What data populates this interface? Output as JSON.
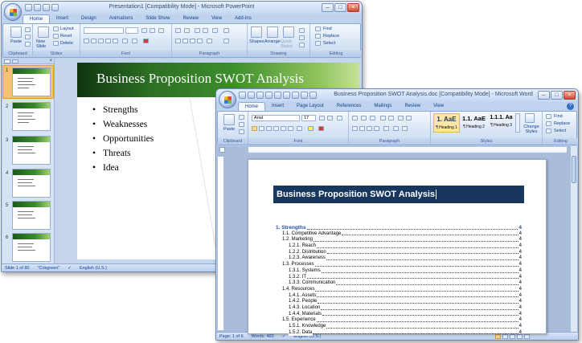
{
  "powerpoint": {
    "title": "Presentation1 [Compatibility Mode] - Microsoft PowerPoint",
    "tabs": [
      "Home",
      "Insert",
      "Design",
      "Animations",
      "Slide Show",
      "Review",
      "View",
      "Add-Ins"
    ],
    "groups": {
      "clipboard": "Clipboard",
      "slides": "Slides",
      "font": "Font",
      "paragraph": "Paragraph",
      "drawing": "Drawing",
      "editing": "Editing"
    },
    "buttons": {
      "paste": "Paste",
      "new_slide": "New Slide",
      "layout": "Layout",
      "reset": "Reset",
      "delete": "Delete",
      "shapes": "Shapes",
      "arrange": "Arrange",
      "quick_styles": "Quick Styles",
      "find": "Find",
      "replace": "Replace",
      "select": "Select"
    },
    "thumbnails": [
      "1",
      "2",
      "3",
      "4",
      "5",
      "6"
    ],
    "slide": {
      "title": "Business Proposition SWOT Analysis",
      "bullets": [
        "Strengths",
        "Weaknesses",
        "Opportunities",
        "Threats",
        "Idea"
      ]
    },
    "status": {
      "slide": "Slide 1 of 80",
      "theme": "\"Crisgreen\"",
      "language": "English (U.S.)"
    }
  },
  "word": {
    "title": "Business Proposition SWOT Analysis.doc [Compatibility Mode] - Microsoft Word",
    "tabs": [
      "Home",
      "Insert",
      "Page Layout",
      "References",
      "Mailings",
      "Review",
      "View"
    ],
    "groups": {
      "clipboard": "Clipboard",
      "font": "Font",
      "paragraph": "Paragraph",
      "styles": "Styles",
      "editing": "Editing"
    },
    "font_name": "Arial",
    "font_size": "17",
    "buttons": {
      "paste": "Paste",
      "change_styles": "Change Styles",
      "find": "Find",
      "replace": "Replace",
      "select": "Select"
    },
    "styles": [
      {
        "preview": "1. AaE",
        "name": "¶ Heading 1"
      },
      {
        "preview": "1.1. AaE",
        "name": "¶ Heading 2"
      },
      {
        "preview": "1.1.1. Aa",
        "name": "¶ Heading 3"
      }
    ],
    "document": {
      "title": "Business Proposition SWOT Analysis",
      "toc": [
        {
          "text": "1. Strengths",
          "page": "4",
          "level": 1
        },
        {
          "text": "1.1. Competitive Advantage",
          "page": "4",
          "level": 2
        },
        {
          "text": "1.2. Marketing",
          "page": "4",
          "level": 2
        },
        {
          "text": "1.2.1. Reach",
          "page": "4",
          "level": 3
        },
        {
          "text": "1.2.2. Distribution",
          "page": "4",
          "level": 3
        },
        {
          "text": "1.2.3. Awareness",
          "page": "4",
          "level": 3
        },
        {
          "text": "1.3. Processes",
          "page": "4",
          "level": 2
        },
        {
          "text": "1.3.1. Systems",
          "page": "4",
          "level": 3
        },
        {
          "text": "1.3.2. IT",
          "page": "4",
          "level": 3
        },
        {
          "text": "1.3.3. Communication",
          "page": "4",
          "level": 3
        },
        {
          "text": "1.4. Resources",
          "page": "4",
          "level": 2
        },
        {
          "text": "1.4.1. Assets",
          "page": "4",
          "level": 3
        },
        {
          "text": "1.4.2. People",
          "page": "4",
          "level": 3
        },
        {
          "text": "1.4.3. Location",
          "page": "4",
          "level": 3
        },
        {
          "text": "1.4.4. Materials",
          "page": "4",
          "level": 3
        },
        {
          "text": "1.5. Experience",
          "page": "4",
          "level": 2
        },
        {
          "text": "1.5.1. Knowledge",
          "page": "4",
          "level": 3
        },
        {
          "text": "1.5.2. Data",
          "page": "4",
          "level": 3
        }
      ]
    },
    "status": {
      "page": "Page: 1 of 6",
      "words": "Words: 483",
      "language": "English (U.S.)"
    }
  }
}
